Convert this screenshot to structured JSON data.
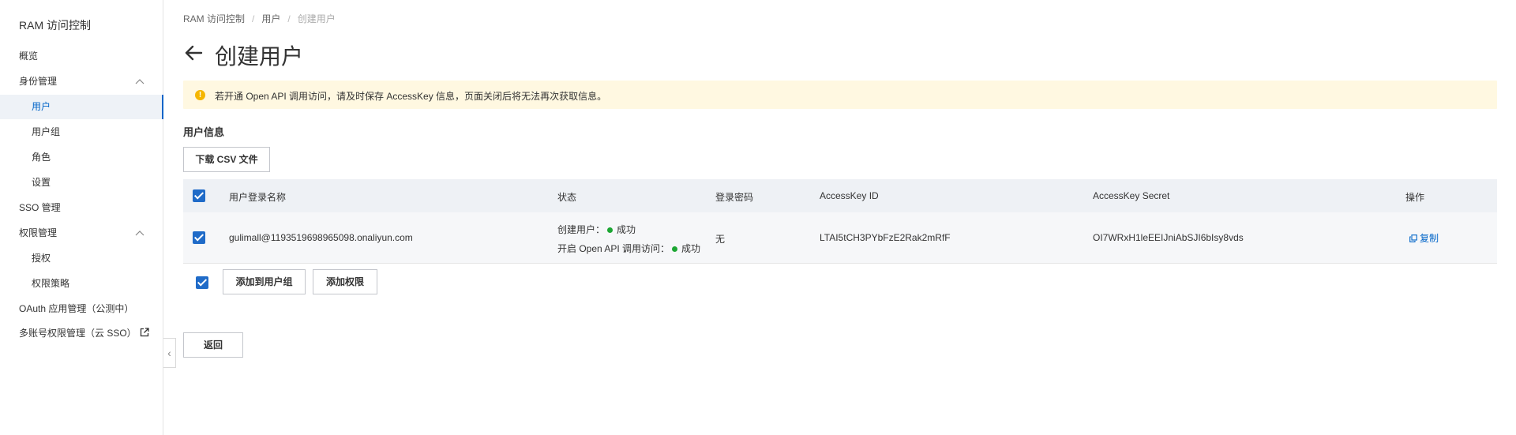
{
  "sidebar": {
    "title": "RAM 访问控制",
    "items": [
      {
        "label": "概览"
      },
      {
        "label": "身份管理",
        "chevron": "^"
      },
      {
        "label": "用户"
      },
      {
        "label": "用户组"
      },
      {
        "label": "角色"
      },
      {
        "label": "设置"
      },
      {
        "label": "SSO 管理"
      },
      {
        "label": "权限管理",
        "chevron": "^"
      },
      {
        "label": "授权"
      },
      {
        "label": "权限策略"
      },
      {
        "label": "OAuth 应用管理（公测中）"
      },
      {
        "label": "多账号权限管理（云 SSO）",
        "icon": "external-link-icon"
      }
    ],
    "collapse_glyph": "‹"
  },
  "breadcrumb": {
    "items": [
      "RAM 访问控制",
      "用户",
      "创建用户"
    ],
    "separator": "/"
  },
  "page_title": "创建用户",
  "alert": {
    "icon": "!",
    "icon_color": "#f5b600",
    "text": "若开通 Open API 调用访问，请及时保存 AccessKey 信息，页面关闭后将无法再次获取信息。"
  },
  "section_title": "用户信息",
  "buttons": {
    "download_csv": "下载 CSV 文件",
    "add_to_group": "添加到用户组",
    "add_permission": "添加权限",
    "back": "返回"
  },
  "table": {
    "columns": [
      "用户登录名称",
      "状态",
      "登录密码",
      "AccessKey ID",
      "AccessKey Secret",
      "操作"
    ],
    "rows": [
      {
        "login_name": "gulimall@1193519698965098.onaliyun.com",
        "status_create_label": "创建用户：",
        "status_create_value": "成功",
        "status_api_label": "开启 Open API 调用访问：",
        "status_api_value": "成功",
        "password": "无",
        "access_key_id": "LTAI5tCH3PYbFzE2Rak2mRfF",
        "access_key_secret": "OI7WRxH1leEEIJniAbSJI6bIsy8vds",
        "action": "复制",
        "checked": true
      }
    ]
  },
  "colors": {
    "accent": "#0064c8",
    "checkbox": "#1f6bc8",
    "success": "#1ca633",
    "alert_bg": "#fff8e1"
  }
}
